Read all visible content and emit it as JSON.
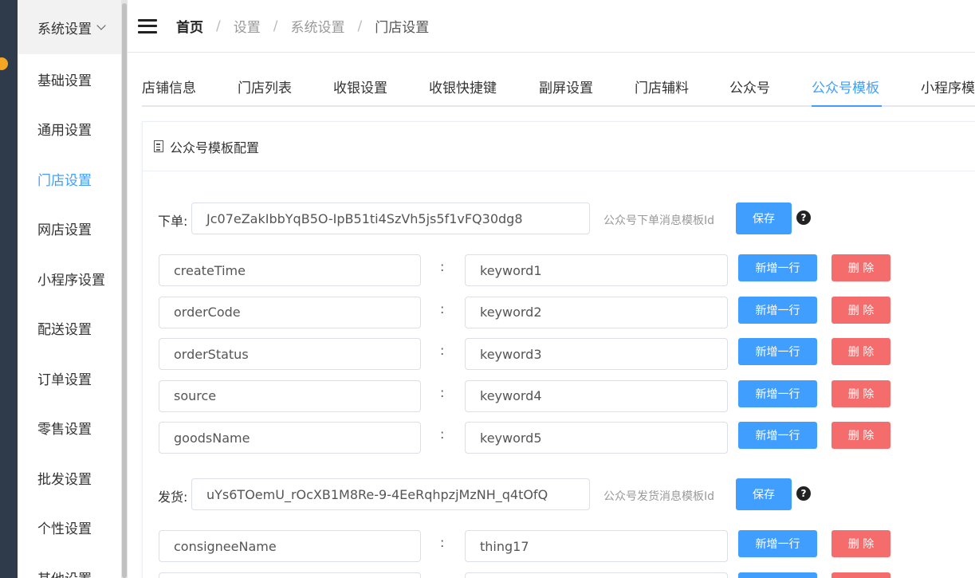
{
  "sidebar": {
    "header": "系统设置",
    "items": [
      "基础设置",
      "通用设置",
      "门店设置",
      "网店设置",
      "小程序设置",
      "配送设置",
      "订单设置",
      "零售设置",
      "批发设置",
      "个性设置",
      "其他设置"
    ],
    "active_index": 2
  },
  "breadcrumb": [
    "首页",
    "设置",
    "系统设置",
    "门店设置"
  ],
  "tabs": [
    "店铺信息",
    "门店列表",
    "收银设置",
    "收银快捷键",
    "副屏设置",
    "门店辅料",
    "公众号",
    "公众号模板",
    "小程序模"
  ],
  "active_tab": 7,
  "card_title": "公众号模板配置",
  "buttons": {
    "save": "保存",
    "add_row": "新增一行",
    "delete": "删 除",
    "help": "?"
  },
  "templates": [
    {
      "label": "下单:",
      "template_id": "Jc07eZakIbbYqB5O-IpB51ti4SzVh5js5f1vFQ30dg8",
      "hint": "公众号下单消息模板Id",
      "rows": [
        {
          "key": "createTime",
          "value": "keyword1"
        },
        {
          "key": "orderCode",
          "value": "keyword2"
        },
        {
          "key": "orderStatus",
          "value": "keyword3"
        },
        {
          "key": "source",
          "value": "keyword4"
        },
        {
          "key": "goodsName",
          "value": "keyword5"
        }
      ]
    },
    {
      "label": "发货:",
      "template_id": "uYs6TOemU_rOcXB1M8Re-9-4EeRqhpzjMzNH_q4tOfQ",
      "hint": "公众号发货消息模板Id",
      "rows": [
        {
          "key": "consigneeName",
          "value": "thing17"
        },
        {
          "key": "",
          "value": ""
        }
      ]
    }
  ]
}
